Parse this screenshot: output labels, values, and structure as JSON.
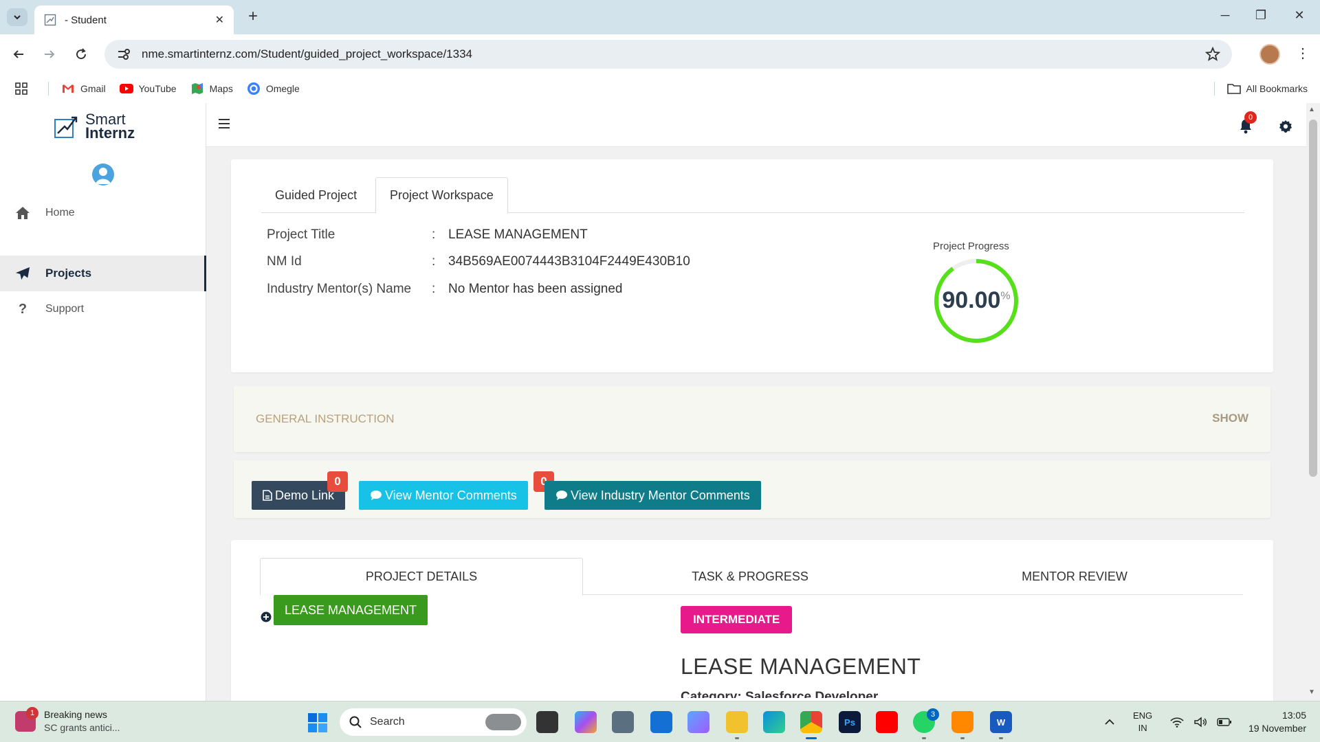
{
  "browser": {
    "tab_title": "- Student",
    "url": "nme.smartinternz.com/Student/guided_project_workspace/1334",
    "bookmarks": [
      "Gmail",
      "YouTube",
      "Maps",
      "Omegle"
    ],
    "all_bookmarks": "All Bookmarks",
    "window_controls": {
      "minimize": "─",
      "restore": "❐",
      "close": "✕"
    },
    "new_tab": "+",
    "close_tab": "✕"
  },
  "brand": {
    "line1": "Smart",
    "line2": "Internz"
  },
  "sidebar": {
    "items": [
      {
        "label": "Home",
        "icon": "home-icon",
        "active": false
      },
      {
        "label": "Projects",
        "icon": "paper-plane-icon",
        "active": true
      },
      {
        "label": "Support",
        "icon": "question-icon",
        "active": false
      }
    ]
  },
  "topbar": {
    "notification_count": "0"
  },
  "project": {
    "tabs": [
      "Guided Project",
      "Project Workspace"
    ],
    "active_tab": "Project Workspace",
    "fields": [
      {
        "label": "Project Title",
        "value": "LEASE MANAGEMENT"
      },
      {
        "label": "NM Id",
        "value": "34B569AE0074443B3104F2449E430B10"
      },
      {
        "label": "Industry Mentor(s) Name",
        "value": "No Mentor has been assigned"
      }
    ],
    "colon": ":",
    "progress_label": "Project Progress",
    "progress_value": "90.00",
    "progress_unit": "%",
    "progress_fraction": 0.9
  },
  "general": {
    "title": "GENERAL INSTRUCTION",
    "toggle": "SHOW"
  },
  "actions": {
    "demo_label": "Demo Link",
    "mentor_label": "View Mentor Comments",
    "mentor_count": "0",
    "industry_label": "View Industry Mentor Comments",
    "industry_count": "0"
  },
  "details": {
    "tabs": [
      "PROJECT DETAILS",
      "TASK & PROGRESS",
      "MENTOR REVIEW"
    ],
    "active_tab": "PROJECT DETAILS",
    "project_button": "LEASE MANAGEMENT",
    "level": "INTERMEDIATE",
    "title": "LEASE MANAGEMENT",
    "category": "Category: Salesforce Developer"
  },
  "taskbar": {
    "news_badge": "1",
    "news_title": "Breaking news",
    "news_sub": "SC grants antici...",
    "search_placeholder": "Search",
    "whatsapp_badge": "3",
    "lang_line1": "ENG",
    "lang_line2": "IN",
    "time": "13:05",
    "date": "19 November"
  },
  "colors": {
    "accent_dark": "#34495e",
    "mentor_btn": "#17c2e6",
    "industry_btn": "#0f7c8a",
    "lease_btn": "#3a9a1e",
    "level_badge": "#e8198b",
    "progress_ring": "#55e01a",
    "badge_red": "#e74c3c"
  }
}
